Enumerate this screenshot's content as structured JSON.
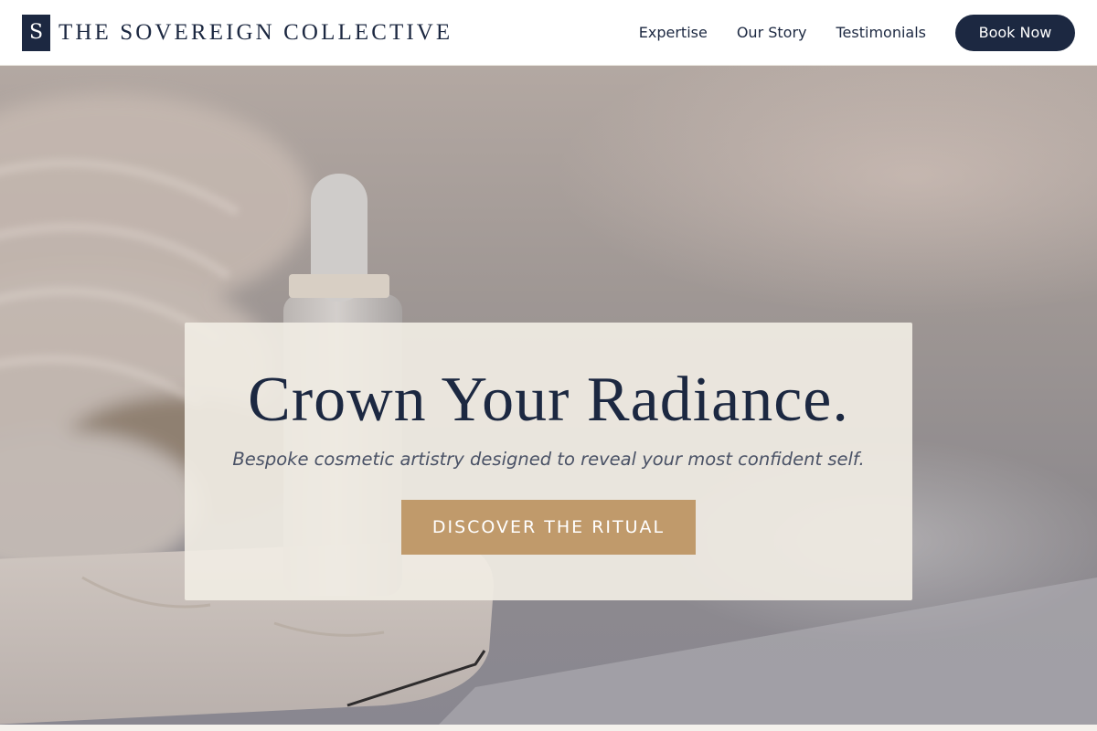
{
  "brand": {
    "mark": "S",
    "name": "THE SOVEREIGN COLLECTIVE"
  },
  "nav": {
    "links": [
      {
        "label": "Expertise"
      },
      {
        "label": "Our Story"
      },
      {
        "label": "Testimonials"
      }
    ],
    "cta_label": "Book Now"
  },
  "hero": {
    "title": "Crown Your Radiance.",
    "subtitle": "Bespoke cosmetic artistry designed to reveal your most confident self.",
    "cta_label": "DISCOVER THE RITUAL",
    "image": "cosmetic-dropper-bottle-on-marble-tray"
  },
  "colors": {
    "navy": "#1c2841",
    "gold": "#c09a6b",
    "cream": "#f0ece3",
    "white": "#ffffff"
  }
}
